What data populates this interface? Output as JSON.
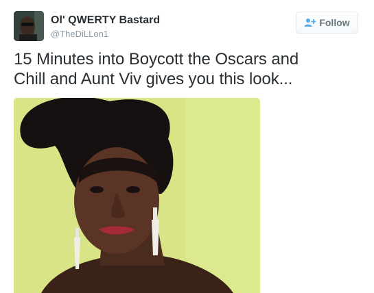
{
  "author": {
    "name": "Ol' QWERTY Bastard",
    "handle": "@TheDiLLon1",
    "avatar_icon": "profile-photo"
  },
  "follow": {
    "label": "Follow",
    "icon": "add-user-icon",
    "accent": "#55acee"
  },
  "tweet": {
    "text_line1": "15 Minutes into Boycott the Oscars and",
    "text_line2": "Chill and Aunt Viv gives you this look..."
  },
  "media": {
    "background_color": "#d9e486"
  }
}
